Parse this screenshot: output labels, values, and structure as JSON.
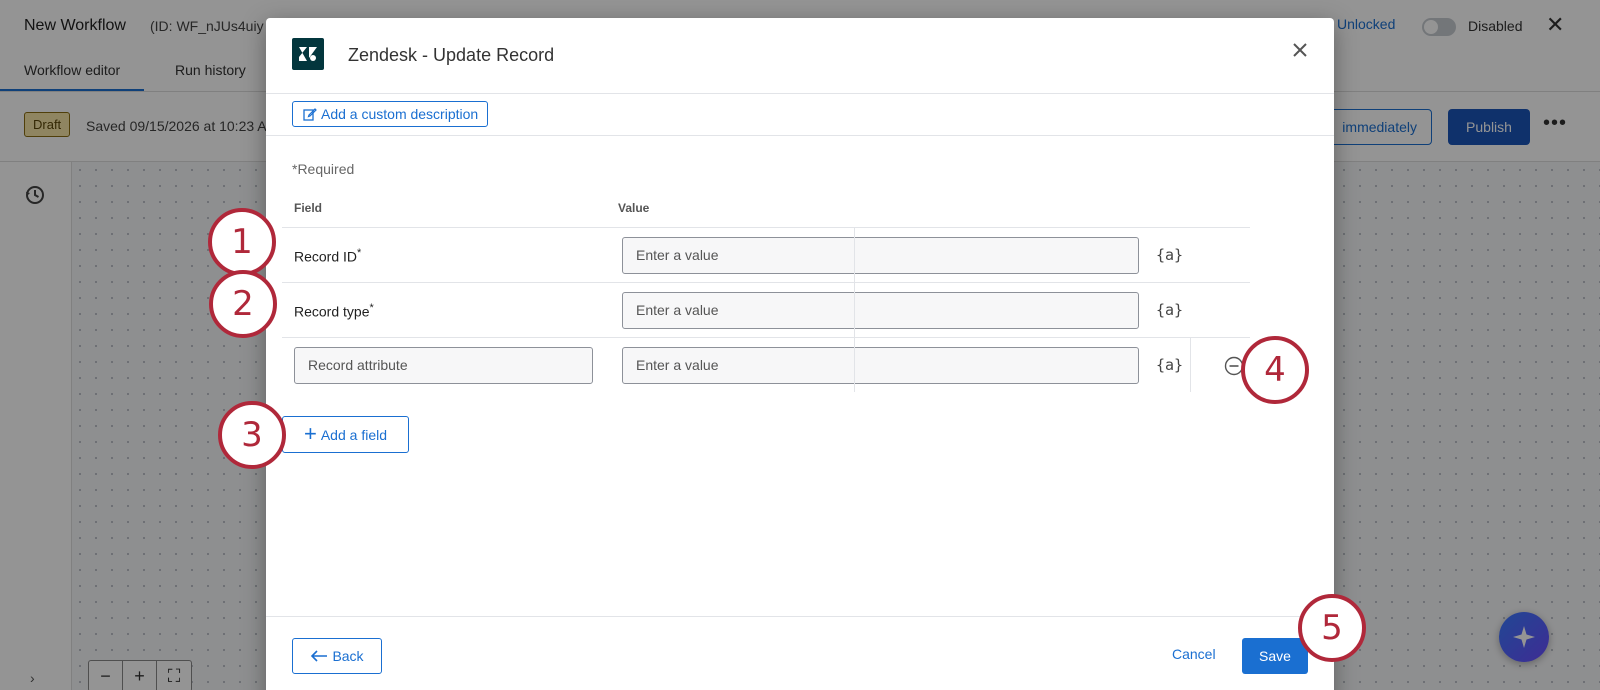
{
  "app": {
    "title": "New Workflow",
    "id_text": "(ID: WF_nJUs4uiy",
    "lock_label": "Unlocked",
    "status_label": "Disabled",
    "tabs": [
      {
        "label": "Workflow editor"
      },
      {
        "label": "Run history"
      }
    ],
    "draft_badge": "Draft",
    "saved_text": "Saved 09/15/2026 at 10:23 A",
    "immediately_label": "immediately",
    "publish_label": "Publish"
  },
  "modal": {
    "title": "Zendesk - Update Record",
    "add_description_label": "Add a custom description",
    "required_note": "*Required",
    "col_field": "Field",
    "col_value": "Value",
    "rows": [
      {
        "field_label": "Record ID",
        "required_mark": "*",
        "value_placeholder": "Enter a value"
      },
      {
        "field_label": "Record type",
        "required_mark": "*",
        "value_placeholder": "Enter a value"
      },
      {
        "field_placeholder": "Record attribute",
        "value_placeholder": "Enter a value"
      }
    ],
    "pipe_text": "{a}",
    "add_field_label": "Add a field",
    "back_label": "Back",
    "cancel_label": "Cancel",
    "save_label": "Save"
  },
  "callouts": [
    "1",
    "2",
    "3",
    "4",
    "5"
  ],
  "colors": {
    "accent": "#1a6fd1",
    "callout": "#b0283a",
    "zendesk_brand": "#03363d"
  }
}
